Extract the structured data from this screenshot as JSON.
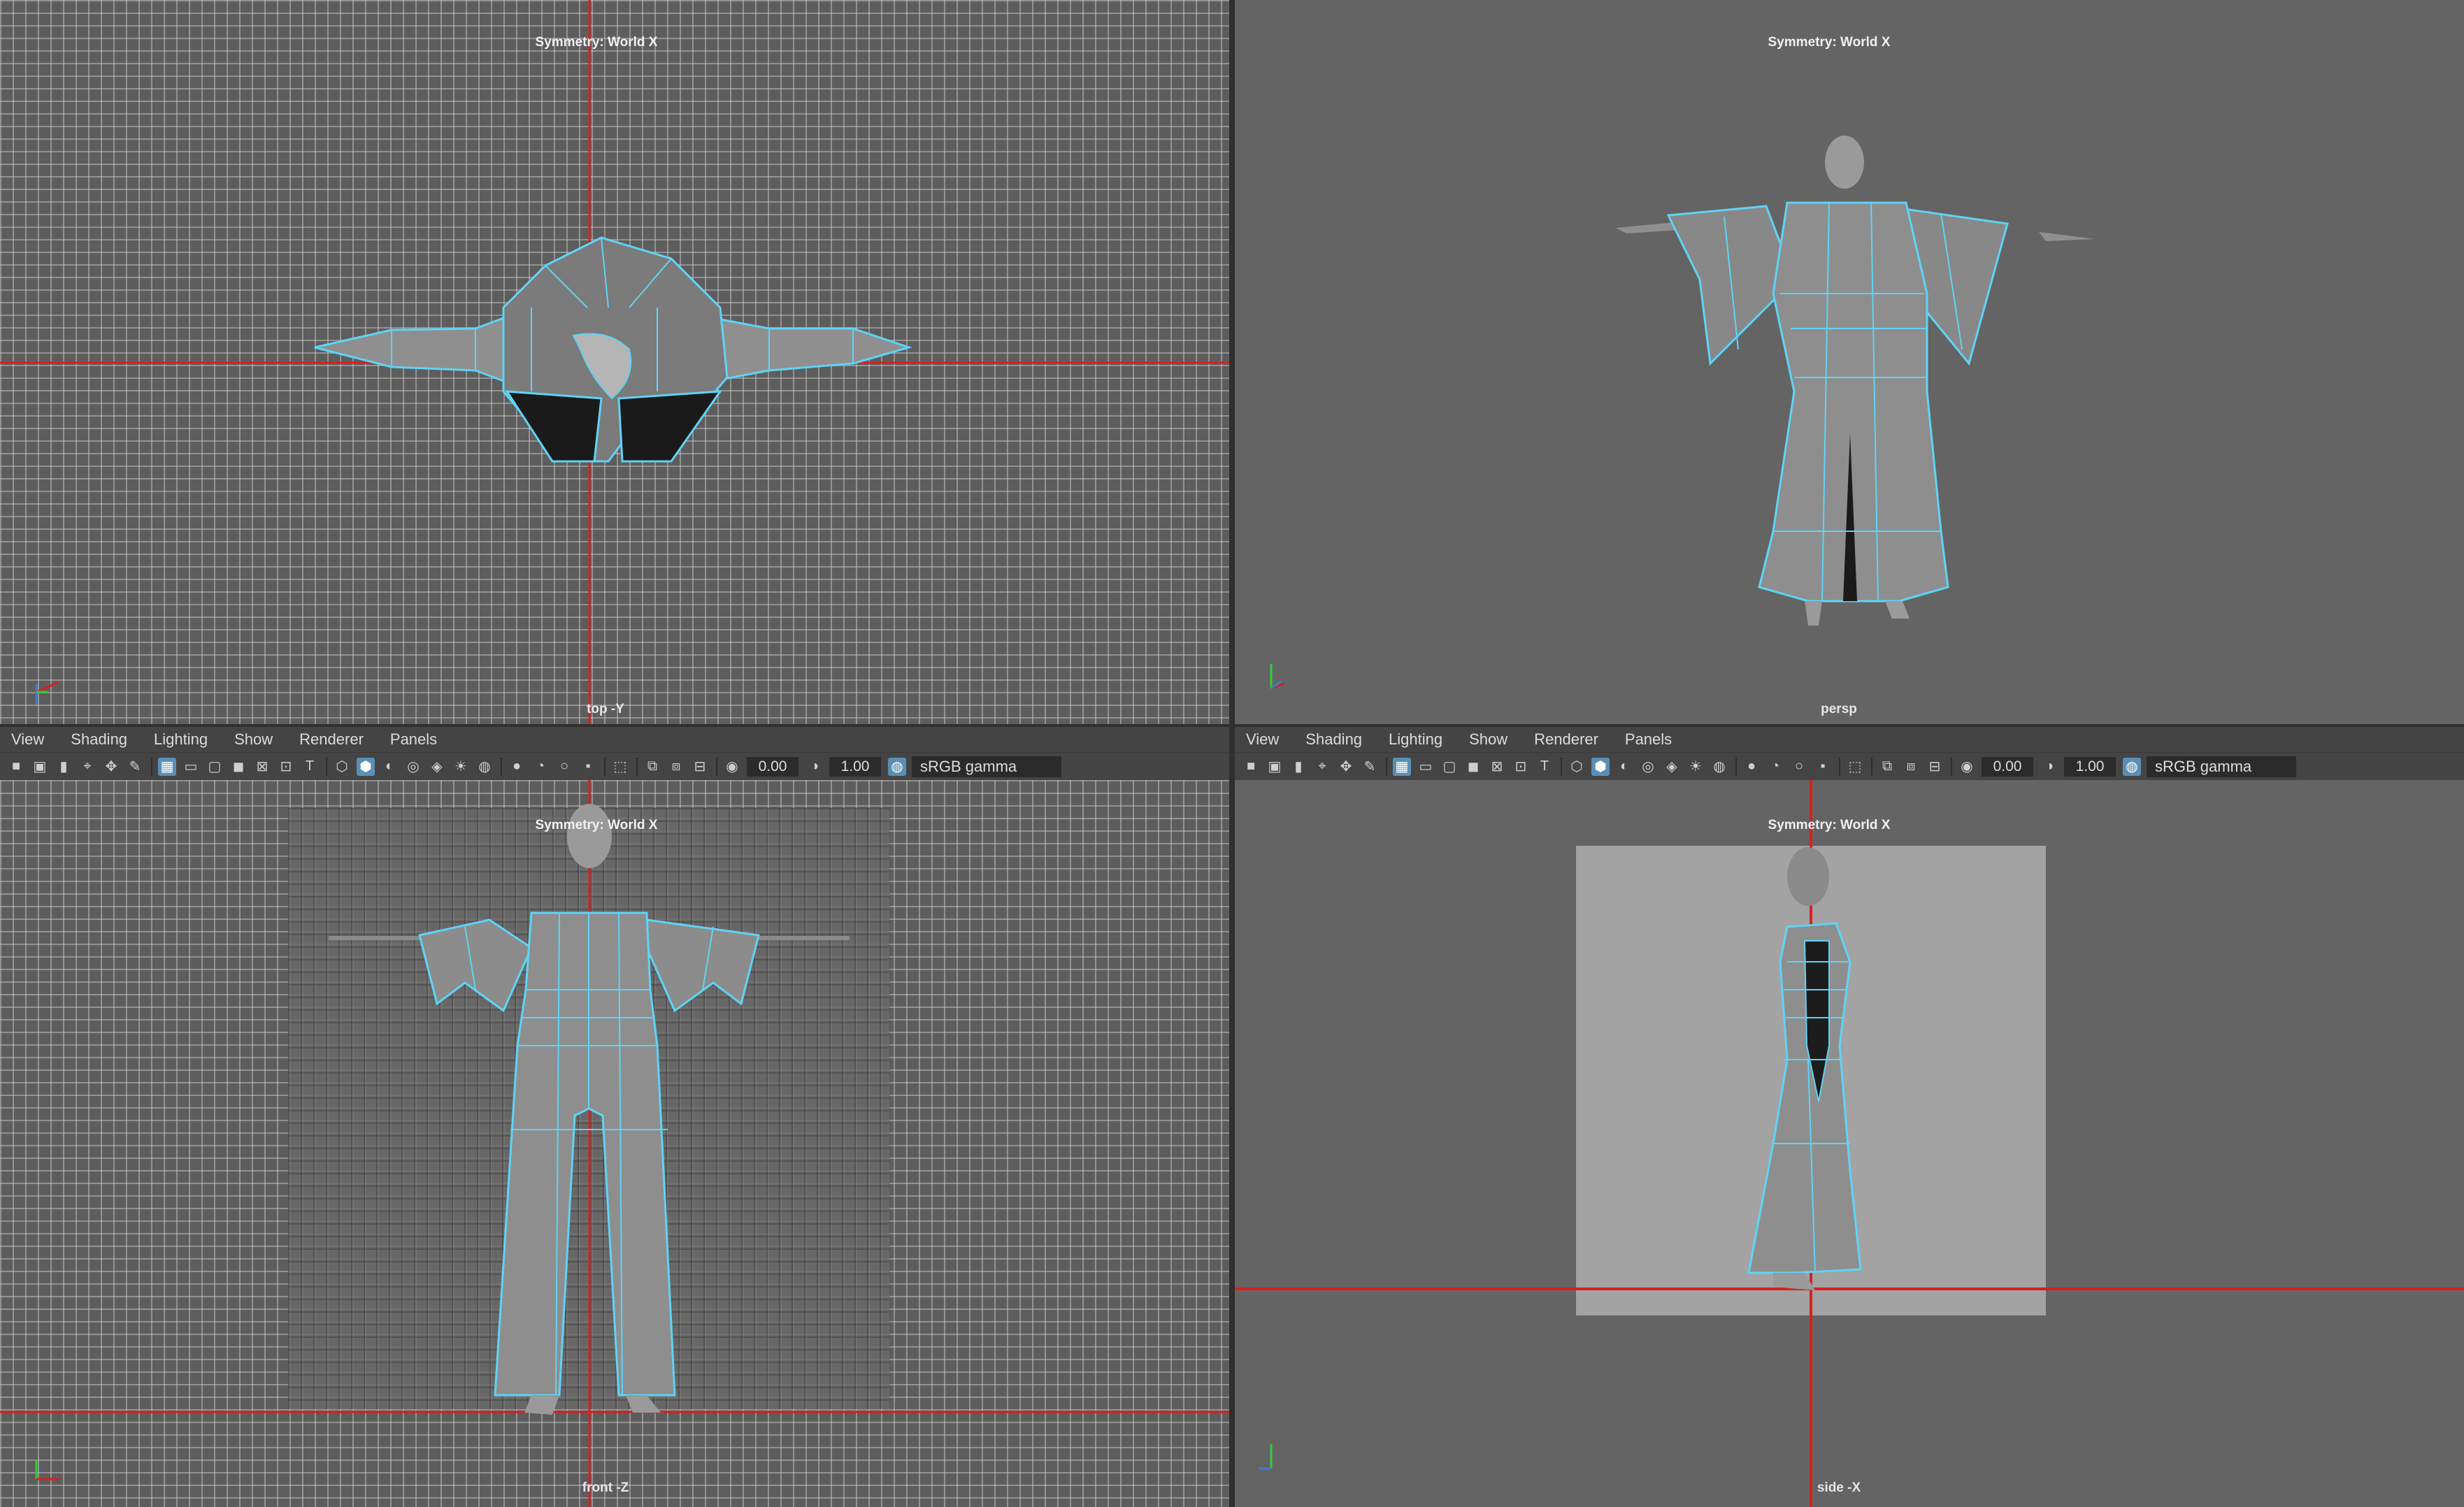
{
  "viewports": {
    "top": {
      "label": "top -Y",
      "symmetry": "Symmetry: World X"
    },
    "persp": {
      "label": "persp",
      "symmetry": "Symmetry: World X"
    },
    "front": {
      "label": "front -Z",
      "symmetry": "Symmetry: World X"
    },
    "side": {
      "label": "side -X",
      "symmetry": "Symmetry: World X"
    }
  },
  "menus": [
    "View",
    "Shading",
    "Lighting",
    "Show",
    "Renderer",
    "Panels"
  ],
  "toolbar": {
    "exposure": "0.00",
    "gamma_value": "1.00",
    "color_space": "sRGB gamma"
  },
  "colors": {
    "wire": "#5fd3f5",
    "axis_red": "#d82020",
    "bg": "#646464"
  }
}
